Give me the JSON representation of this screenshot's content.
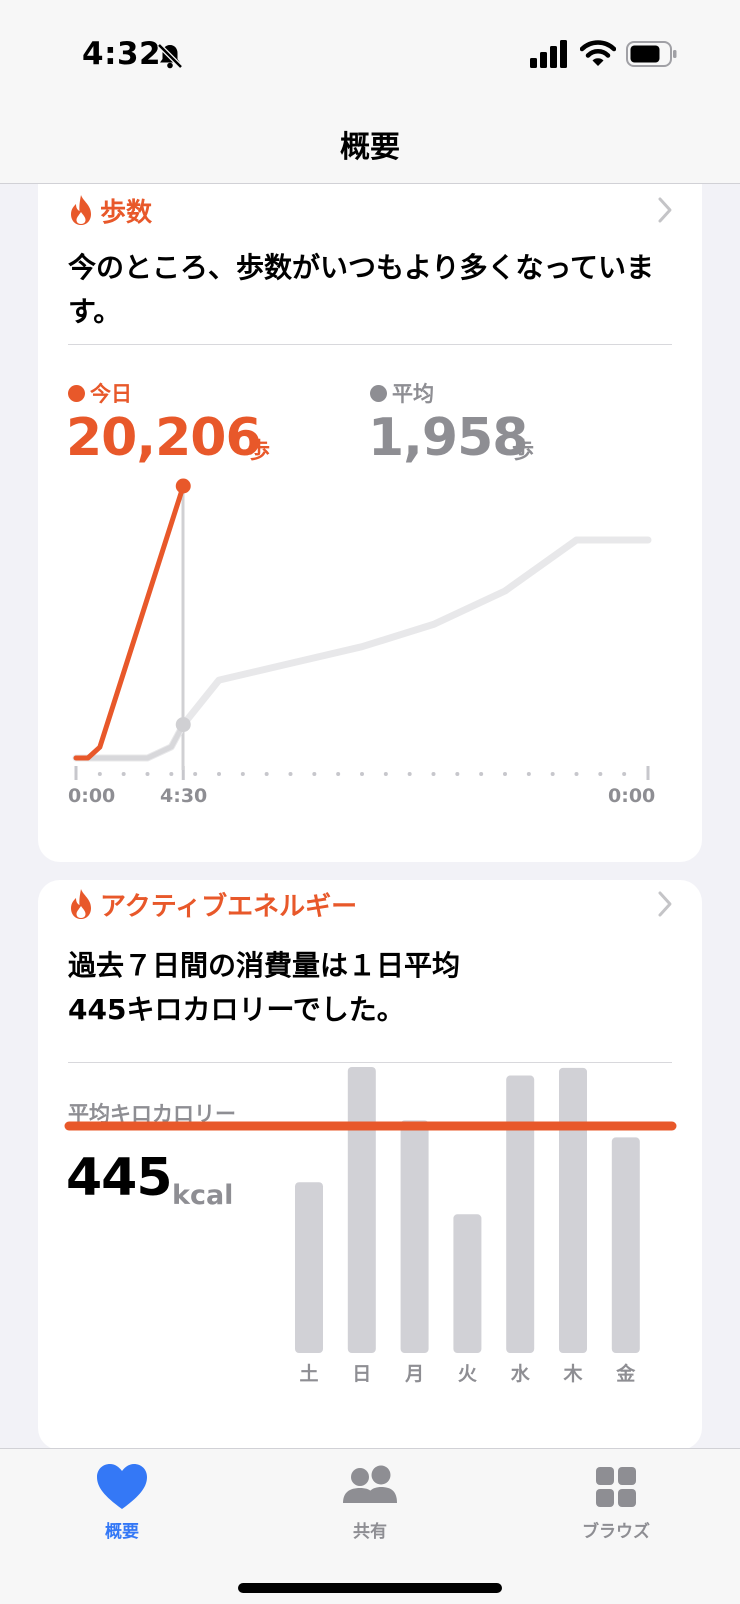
{
  "status_bar": {
    "time": "4:32"
  },
  "nav": {
    "title": "概要"
  },
  "colors": {
    "accent": "#e8582a",
    "gray": "#8e8e93",
    "tab_active": "#3478f6"
  },
  "steps_card": {
    "title": "歩数",
    "message": "今のところ、歩数がいつもより多くなっています。",
    "today_label": "今日",
    "today_value": "20,206",
    "today_unit": "歩",
    "average_label": "平均",
    "average_value": "1,958",
    "average_unit": "歩",
    "x_labels": [
      "0:00",
      "4:30",
      "0:00"
    ]
  },
  "energy_card": {
    "title": "アクティブエネルギー",
    "message_line1": "過去７日間の消費量は１日平均",
    "message_line2": "445キロカロリーでした。",
    "avg_label": "平均キロカロリー",
    "avg_value": "445",
    "avg_unit": "kcal"
  },
  "chart_data": [
    {
      "type": "line",
      "x_labels": [
        "0:00",
        "4:30",
        "0:00"
      ],
      "series": [
        {
          "name": "今日",
          "x": [
            0,
            0.5,
            1,
            4.5
          ],
          "values": [
            0,
            0,
            800,
            20206
          ]
        },
        {
          "name": "平均",
          "x": [
            0,
            3,
            4,
            4.5,
            6,
            9,
            12,
            15,
            18,
            21,
            24
          ],
          "values": [
            0,
            0,
            100,
            300,
            700,
            850,
            1000,
            1200,
            1500,
            1958,
            1958
          ]
        }
      ]
    },
    {
      "type": "bar",
      "categories": [
        "土",
        "日",
        "月",
        "火",
        "水",
        "木",
        "金"
      ],
      "values": [
        400,
        670,
        545,
        325,
        650,
        668,
        505
      ],
      "average": 445
    }
  ],
  "tabs": [
    {
      "label": "概要",
      "icon": "heart-icon",
      "active": true
    },
    {
      "label": "共有",
      "icon": "people-icon",
      "active": false
    },
    {
      "label": "ブラウズ",
      "icon": "grid-icon",
      "active": false
    }
  ]
}
